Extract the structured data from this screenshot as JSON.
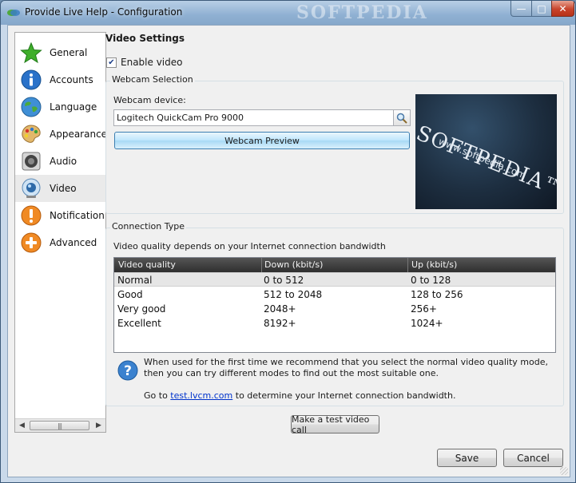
{
  "window": {
    "title": "Provide Live Help - Configuration",
    "watermark": "SOFTPEDIA"
  },
  "sidebar": {
    "items": [
      {
        "label": "General",
        "icon": "star-icon"
      },
      {
        "label": "Accounts",
        "icon": "info-icon"
      },
      {
        "label": "Language",
        "icon": "globe-icon"
      },
      {
        "label": "Appearance",
        "icon": "palette-icon"
      },
      {
        "label": "Audio",
        "icon": "speaker-icon"
      },
      {
        "label": "Video",
        "icon": "webcam-icon",
        "selected": true
      },
      {
        "label": "Notification",
        "icon": "exclamation-icon"
      },
      {
        "label": "Advanced",
        "icon": "plus-icon"
      }
    ]
  },
  "video": {
    "section_title": "Video Settings",
    "enable_label": "Enable video",
    "enabled": true,
    "webcam_group_title": "Webcam Selection",
    "device_label": "Webcam device:",
    "device_value": "Logitech QuickCam Pro 9000",
    "preview_button": "Webcam Preview",
    "preview_text_big": "SOFTPEDIA™",
    "preview_text_small": "www.softpedia.com"
  },
  "connection": {
    "group_title": "Connection Type",
    "description": "Video quality depends on your Internet connection bandwidth",
    "columns": [
      "Video quality",
      "Down (kbit/s)",
      "Up (kbit/s)"
    ],
    "rows": [
      [
        "Normal",
        "0 to 512",
        "0 to 128"
      ],
      [
        "Good",
        "512 to 2048",
        "128 to 256"
      ],
      [
        "Very good",
        "2048+",
        "256+"
      ],
      [
        "Excellent",
        "8192+",
        "1024+"
      ]
    ],
    "selected_row": 0,
    "help_text": "When used for the first time we recommend that you select the normal video quality mode, then you can try different modes to find out the most suitable one.",
    "goto_prefix": "Go to",
    "goto_link": "test.lvcm.com",
    "goto_suffix": "to determine your Internet connection bandwidth."
  },
  "buttons": {
    "test_call": "Make a test video call",
    "save": "Save",
    "cancel": "Cancel"
  },
  "colors": {
    "accent": "#3c7fb1",
    "table_header": "#3a3a3a",
    "link": "#0033cc"
  }
}
